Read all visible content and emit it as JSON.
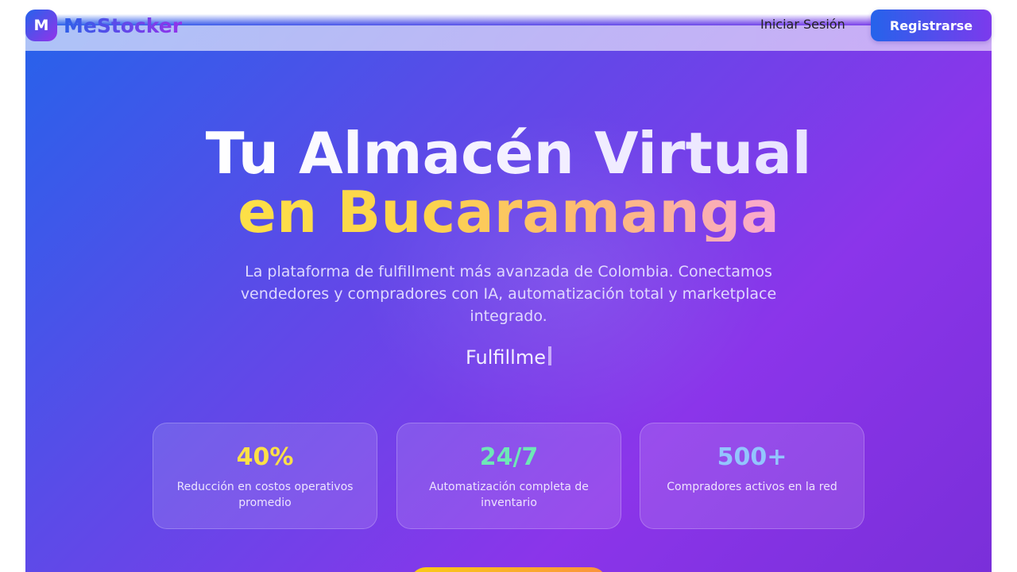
{
  "header": {
    "logo_letter": "M",
    "logo_text": "MeStocker",
    "login_label": "Iniciar Sesión",
    "register_label": "Registrarse"
  },
  "hero": {
    "title_line1": "Tu Almacén Virtual",
    "title_line2": "en Bucaramanga",
    "subtitle": "La plataforma de fulfillment más avanzada de Colombia. Conectamos vendedores y compradores con IA, automatización total y marketplace integrado.",
    "typing_text": "Fulfillme"
  },
  "stats": [
    {
      "value": "40%",
      "description": "Reducción en costos operativos promedio",
      "color": "#fde047"
    },
    {
      "value": "24/7",
      "description": "Automatización completa de inventario",
      "color": "#6ee7b7"
    },
    {
      "value": "500+",
      "description": "Compradores activos en la red",
      "color": "#93c5fd"
    }
  ],
  "colors": {
    "primary_blue": "#2563eb",
    "primary_purple": "#9333ea",
    "cta_yellow": "#facc15",
    "cta_orange": "#fb923c"
  }
}
